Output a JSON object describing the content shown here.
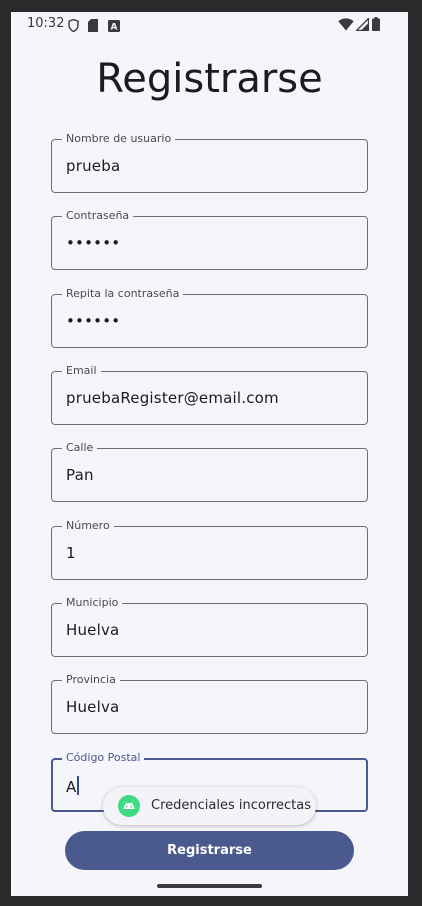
{
  "status_bar": {
    "time": "10:32",
    "icons": [
      "shield-icon",
      "sd-card-icon",
      "keyboard-a-icon",
      "wifi-icon",
      "cellular-signal-icon",
      "battery-icon"
    ]
  },
  "title": "Registrarse",
  "fields": [
    {
      "label": "Nombre de usuario",
      "value": "prueba"
    },
    {
      "label": "Contraseña",
      "value": "••••••"
    },
    {
      "label": "Repita la contraseña",
      "value": "••••••"
    },
    {
      "label": "Email",
      "value": "pruebaRegister@email.com"
    },
    {
      "label": "Calle",
      "value": "Pan"
    },
    {
      "label": "Número",
      "value": "1"
    },
    {
      "label": "Municipio",
      "value": "Huelva"
    },
    {
      "label": "Provincia",
      "value": "Huelva"
    },
    {
      "label": "Código Postal",
      "value": "A",
      "focused": true
    }
  ],
  "toast": {
    "icon": "android-icon",
    "text": "Credenciales incorrectas"
  },
  "register_button": {
    "label": "Registrarse"
  },
  "colors": {
    "primary": "#4a5a8f",
    "background": "#f6f5fb",
    "toast_icon": "#3ddc84"
  }
}
